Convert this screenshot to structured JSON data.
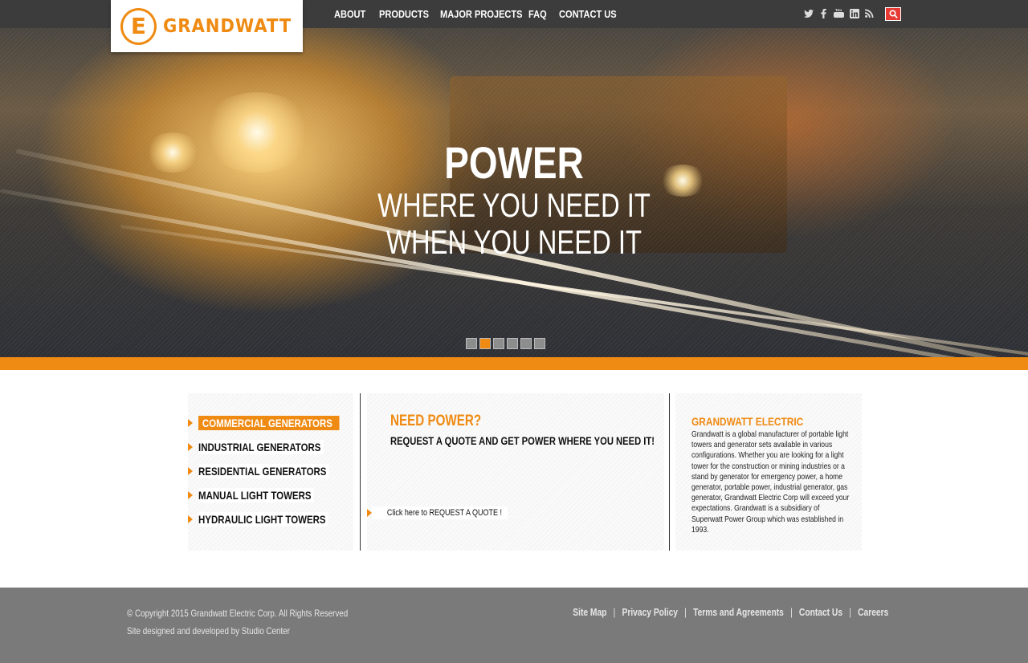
{
  "brand": {
    "name": "GRANDWATT",
    "logo_letter": "E"
  },
  "nav": {
    "items": [
      "ABOUT",
      "PRODUCTS",
      "MAJOR PROJECTS",
      "FAQ",
      "CONTACT US"
    ]
  },
  "social": {
    "icons": [
      "twitter-icon",
      "facebook-icon",
      "youtube-icon",
      "linkedin-icon",
      "rss-icon"
    ]
  },
  "hero": {
    "line1": "POWER",
    "line2": "WHERE YOU NEED IT",
    "line3": "WHEN YOU NEED IT",
    "slide_count": 6,
    "active_slide": 2
  },
  "products": {
    "items": [
      "COMMERCIAL GENERATORS",
      "INDUSTRIAL GENERATORS",
      "RESIDENTIAL GENERATORS",
      "MANUAL LIGHT TOWERS",
      "HYDRAULIC LIGHT TOWERS"
    ],
    "active_index": 0
  },
  "quote": {
    "title": "NEED POWER?",
    "subtitle": "REQUEST A QUOTE AND GET POWER WHERE YOU NEED IT!",
    "link": "Click here to REQUEST A QUOTE !"
  },
  "about": {
    "title": "GRANDWATT ELECTRIC",
    "body": "Grandwatt is a global manufacturer of portable light towers and generator sets available in various configurations. Whether you are looking for a light tower for the construction or mining industries or a stand by generator for emergency power, a home generator, portable power, industrial generator, gas generator, Grandwatt Electric Corp will exceed your expectations. Grandwatt is a subsidiary of Superwatt Power Group which was established in 1993."
  },
  "footer": {
    "copyright": "© Copyright 2015 Grandwatt Electric Corp. All Rights Reserved",
    "credit": "Site designed and developed by Studio Center",
    "links": [
      "Site Map",
      "Privacy Policy",
      "Terms and Agreements",
      "Contact Us",
      "Careers"
    ]
  },
  "colors": {
    "accent": "#ef8a12",
    "topbar": "#3c3c3c",
    "footer": "#7a7a7a",
    "search": "#e63a33"
  }
}
